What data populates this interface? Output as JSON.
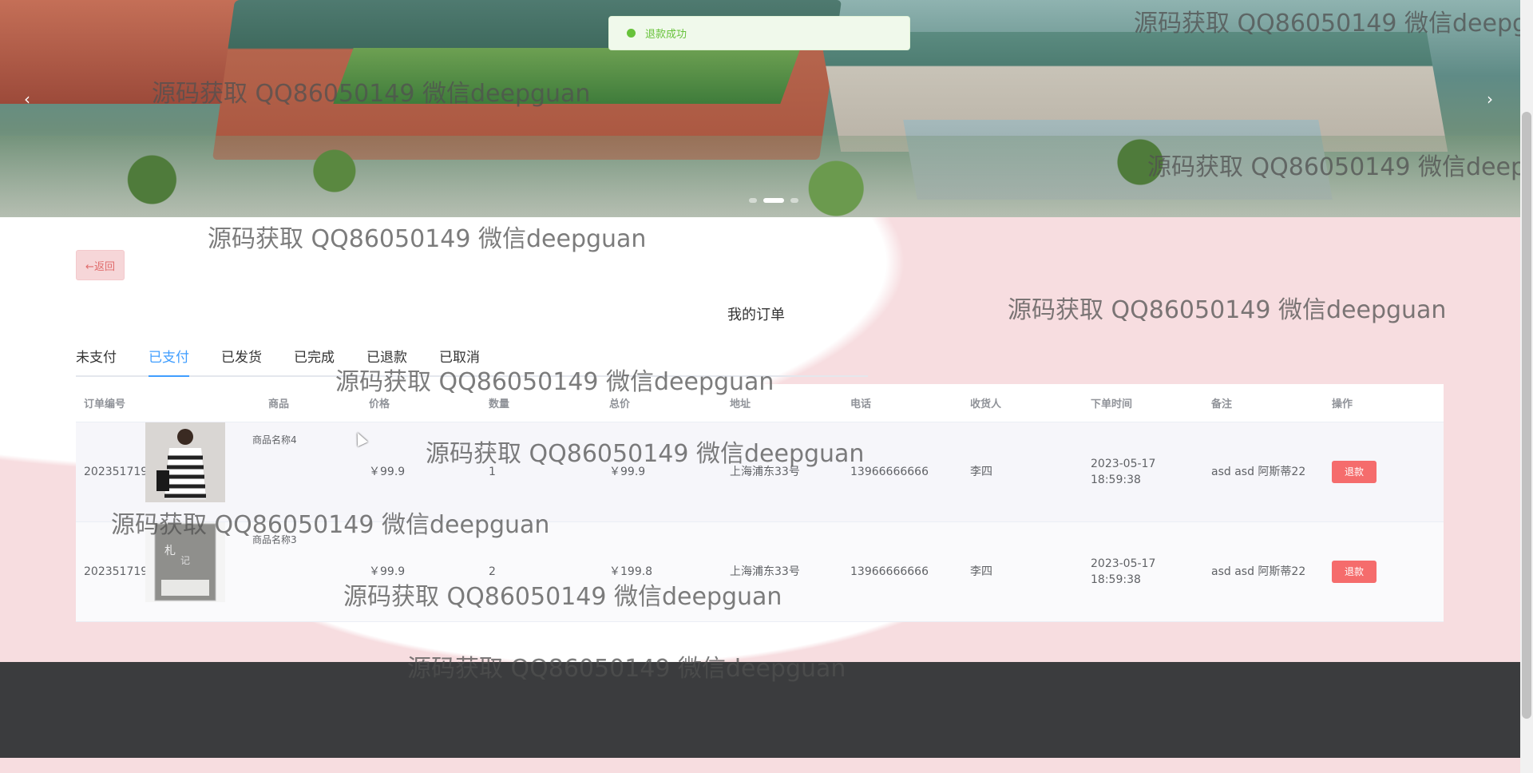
{
  "toast": {
    "message": "退款成功"
  },
  "carousel": {
    "prev_icon": "‹",
    "next_icon": "›"
  },
  "back_button": "←返回",
  "page_title": "我的订单",
  "tabs": [
    {
      "label": "未支付",
      "active": false
    },
    {
      "label": "已支付",
      "active": true
    },
    {
      "label": "已发货",
      "active": false
    },
    {
      "label": "已完成",
      "active": false
    },
    {
      "label": "已退款",
      "active": false
    },
    {
      "label": "已取消",
      "active": false
    }
  ],
  "table": {
    "headers": [
      "订单编号",
      "商品",
      "价格",
      "数量",
      "总价",
      "地址",
      "电话",
      "收货人",
      "下单时间",
      "备注",
      "操作"
    ],
    "rows": [
      {
        "order_no": "202351719141431",
        "product_name": "商品名称4",
        "price": "￥99.9",
        "qty": "1",
        "total": "￥99.9",
        "address": "上海浦东33号",
        "phone": "13966666666",
        "receiver": "李四",
        "time": "2023-05-17 18:59:38",
        "note": "asd asd 阿斯蒂22",
        "action": "退款"
      },
      {
        "order_no": "202351719141429",
        "product_name": "商品名称3",
        "price": "￥99.9",
        "qty": "2",
        "total": "￥199.8",
        "address": "上海浦东33号",
        "phone": "13966666666",
        "receiver": "李四",
        "time": "2023-05-17 18:59:38",
        "note": "asd asd 阿斯蒂22",
        "action": "退款"
      }
    ]
  },
  "watermark": "源码获取 QQ86050149 微信deepguan",
  "colors": {
    "primary": "#409eff",
    "danger": "#f56c6c",
    "success": "#67c23a",
    "footer": "#3b3c3e"
  }
}
